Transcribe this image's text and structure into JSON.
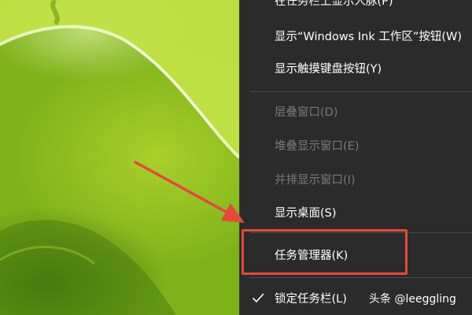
{
  "context_menu": {
    "items": [
      {
        "label": "在任务栏上显示人脉(P)",
        "enabled": true
      },
      {
        "label": "显示“Windows Ink 工作区”按钮(W)",
        "enabled": true
      },
      {
        "label": "显示触摸键盘按钮(Y)",
        "enabled": true
      },
      {
        "label": "层叠窗口(D)",
        "enabled": false
      },
      {
        "label": "堆叠显示窗口(E)",
        "enabled": false
      },
      {
        "label": "并排显示窗口(I)",
        "enabled": false
      },
      {
        "label": "显示桌面(S)",
        "enabled": true
      },
      {
        "label": "任务管理器(K)",
        "enabled": true,
        "highlighted": true
      },
      {
        "label": "锁定任务栏(L)",
        "enabled": true,
        "checked": true
      }
    ]
  },
  "annotation": {
    "highlight_color": "#e14a3b",
    "arrow_color": "#e14a3b",
    "points_to": "任务管理器(K)"
  },
  "watermark": "头条 @leeggling",
  "icons": {
    "check": "check-icon"
  },
  "colors": {
    "menu_background": "#2b2b2b",
    "enabled_text": "#ffffff",
    "disabled_text": "#7a7a7a",
    "wallpaper": "#98c626"
  }
}
